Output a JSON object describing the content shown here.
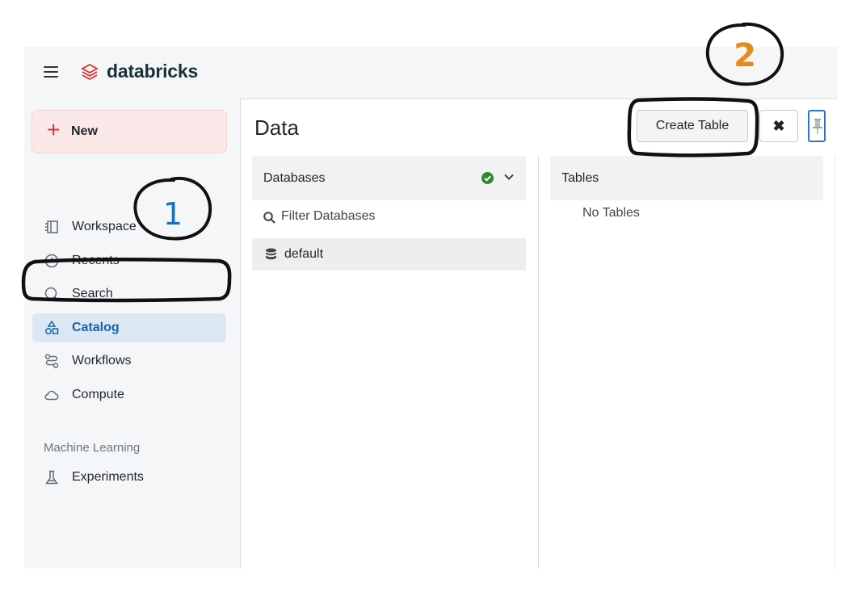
{
  "app": {
    "logo_text": "databricks"
  },
  "sidebar": {
    "new_label": "New",
    "items": [
      {
        "label": "Workspace",
        "icon": "workspace-icon"
      },
      {
        "label": "Recents",
        "icon": "clock-icon"
      },
      {
        "label": "Search",
        "icon": "search-icon"
      },
      {
        "label": "Catalog",
        "icon": "catalog-icon",
        "active": true
      },
      {
        "label": "Workflows",
        "icon": "workflows-icon"
      },
      {
        "label": "Compute",
        "icon": "cloud-icon"
      }
    ],
    "section_label": "Machine Learning",
    "ml_items": [
      {
        "label": "Experiments",
        "icon": "flask-icon"
      }
    ]
  },
  "main": {
    "title": "Data",
    "create_table_label": "Create Table",
    "close_label": "✖",
    "databases": {
      "header": "Databases",
      "filter_placeholder": "Filter Databases",
      "items": [
        "default"
      ]
    },
    "tables": {
      "header": "Tables",
      "empty_text": "No Tables"
    }
  },
  "annotations": {
    "step1": "1",
    "step2": "2"
  },
  "colors": {
    "brand": "#e0312b",
    "active": "#1b62a8",
    "step1": "#1b6fc2",
    "step2": "#e8891c"
  }
}
